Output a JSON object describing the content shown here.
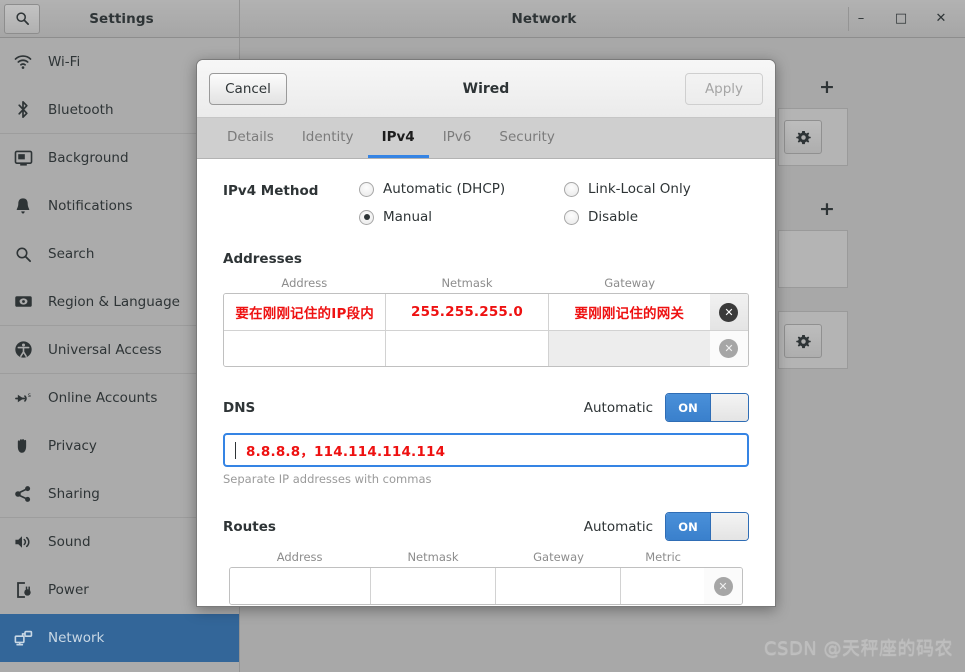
{
  "window": {
    "sidebar_title": "Settings",
    "main_title": "Network",
    "search_icon": "search-icon",
    "controls": {
      "minimize": "–",
      "maximize": "□",
      "close": "✕"
    }
  },
  "sidebar": {
    "items": [
      {
        "label": "Wi-Fi",
        "icon": "wifi-icon"
      },
      {
        "label": "Bluetooth",
        "icon": "bluetooth-icon"
      },
      {
        "label": "Background",
        "icon": "background-icon"
      },
      {
        "label": "Notifications",
        "icon": "bell-icon"
      },
      {
        "label": "Search",
        "icon": "search-icon"
      },
      {
        "label": "Region & Language",
        "icon": "region-language-icon"
      },
      {
        "label": "Universal Access",
        "icon": "universal-access-icon"
      },
      {
        "label": "Online Accounts",
        "icon": "online-accounts-icon"
      },
      {
        "label": "Privacy",
        "icon": "privacy-hand-icon"
      },
      {
        "label": "Sharing",
        "icon": "sharing-icon"
      },
      {
        "label": "Sound",
        "icon": "sound-icon"
      },
      {
        "label": "Power",
        "icon": "power-icon"
      },
      {
        "label": "Network",
        "icon": "network-icon"
      }
    ],
    "active_index": 12
  },
  "background_panel": {
    "add_buttons": [
      "+",
      "+"
    ],
    "gear_icon": "gear-icon"
  },
  "dialog": {
    "cancel_label": "Cancel",
    "title": "Wired",
    "apply_label": "Apply",
    "tabs": [
      {
        "label": "Details",
        "active": false
      },
      {
        "label": "Identity",
        "active": false
      },
      {
        "label": "IPv4",
        "active": true
      },
      {
        "label": "IPv6",
        "active": false
      },
      {
        "label": "Security",
        "active": false
      }
    ],
    "method": {
      "label": "IPv4 Method",
      "options": [
        {
          "label": "Automatic (DHCP)",
          "checked": false
        },
        {
          "label": "Link-Local Only",
          "checked": false
        },
        {
          "label": "Manual",
          "checked": true
        },
        {
          "label": "Disable",
          "checked": false
        }
      ]
    },
    "addresses": {
      "label": "Addresses",
      "columns": [
        "Address",
        "Netmask",
        "Gateway"
      ],
      "rows": [
        {
          "address": "要在刚刚记住的IP段内",
          "netmask": "255.255.255.0",
          "gateway": "要刚刚记住的网关",
          "annotated": true
        },
        {
          "address": "",
          "netmask": "",
          "gateway": "",
          "annotated": false
        }
      ]
    },
    "dns": {
      "label": "DNS",
      "automatic_label": "Automatic",
      "toggle_state": "ON",
      "value": "8.8.8.8，114.114.114.114",
      "hint": "Separate IP addresses with commas"
    },
    "routes": {
      "label": "Routes",
      "automatic_label": "Automatic",
      "toggle_state": "ON",
      "columns": [
        "Address",
        "Netmask",
        "Gateway",
        "Metric"
      ],
      "rows": [
        {
          "address": "",
          "netmask": "",
          "gateway": "",
          "metric": ""
        }
      ]
    }
  },
  "watermark": "CSDN @天秤座的码农",
  "colors": {
    "accent": "#3584e4",
    "sidebar_active": "#336699",
    "annotation_red": "#ee1111",
    "toggle_on": "#4a90d9"
  }
}
